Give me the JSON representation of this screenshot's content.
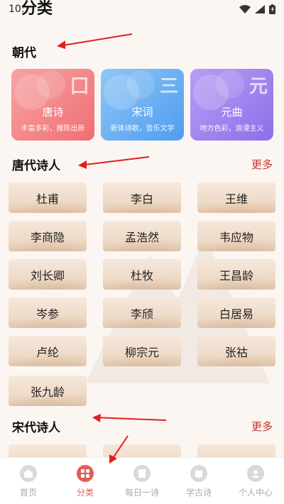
{
  "status": {
    "time": "10:"
  },
  "page": {
    "title": "分类"
  },
  "sections": {
    "dynasty": {
      "title": "朝代"
    },
    "tang": {
      "title": "唐代诗人",
      "more": "更多"
    },
    "song": {
      "title": "宋代诗人",
      "more": "更多"
    }
  },
  "dynasties": [
    {
      "name": "唐诗",
      "subtitle": "丰富多彩，推陈出新",
      "glyph": "囗",
      "color": "#ef6f72"
    },
    {
      "name": "宋词",
      "subtitle": "新体诗歌，音乐文学",
      "glyph": "三",
      "color": "#4f9df0"
    },
    {
      "name": "元曲",
      "subtitle": "地方色彩，浪漫主义",
      "glyph": "元",
      "color": "#8c6fe8"
    }
  ],
  "tang_poets": [
    "杜甫",
    "李白",
    "王维",
    "李商隐",
    "孟浩然",
    "韦应物",
    "刘长卿",
    "杜牧",
    "王昌龄",
    "岑参",
    "李颀",
    "白居易",
    "卢纶",
    "柳宗元",
    "张祜",
    "张九龄"
  ],
  "tabs": [
    {
      "label": "首页",
      "icon": "home-icon"
    },
    {
      "label": "分类",
      "icon": "category-icon"
    },
    {
      "label": "每日一诗",
      "icon": "daily-poem-icon"
    },
    {
      "label": "学古诗",
      "icon": "book-icon"
    },
    {
      "label": "个人中心",
      "icon": "user-icon"
    }
  ],
  "colors": {
    "accent": "#e55a55",
    "more": "#c8302c",
    "annotation_arrow": "#e0201c"
  }
}
